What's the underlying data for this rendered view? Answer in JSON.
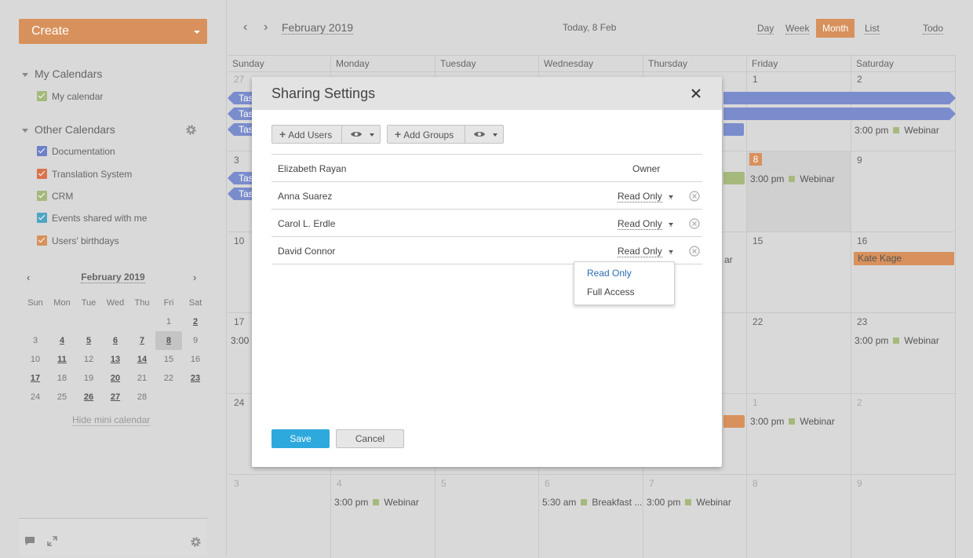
{
  "sidebar": {
    "create_label": "Create",
    "my_calendars_title": "My Calendars",
    "my_calendars": [
      {
        "label": "My calendar",
        "color": "#a6b97c"
      }
    ],
    "other_calendars_title": "Other Calendars",
    "other_calendars": [
      {
        "label": "Documentation",
        "color": "#6d80c8"
      },
      {
        "label": "Translation System",
        "color": "#d8744e"
      },
      {
        "label": "CRM",
        "color": "#a6b97c"
      },
      {
        "label": "Events shared with me",
        "color": "#4fa6c3"
      },
      {
        "label": "Users' birthdays",
        "color": "#d8915c"
      }
    ],
    "mini_calendar": {
      "title": "February 2019",
      "weekdays": [
        "Sun",
        "Mon",
        "Tue",
        "Wed",
        "Thu",
        "Fri",
        "Sat"
      ],
      "days": [
        {
          "d": "",
          "s": ""
        },
        {
          "d": "",
          "s": ""
        },
        {
          "d": "",
          "s": ""
        },
        {
          "d": "",
          "s": ""
        },
        {
          "d": "",
          "s": ""
        },
        {
          "d": "1",
          "s": ""
        },
        {
          "d": "2",
          "s": "b"
        },
        {
          "d": "3",
          "s": ""
        },
        {
          "d": "4",
          "s": "b"
        },
        {
          "d": "5",
          "s": "b"
        },
        {
          "d": "6",
          "s": "b"
        },
        {
          "d": "7",
          "s": "b"
        },
        {
          "d": "8",
          "s": "today"
        },
        {
          "d": "9",
          "s": ""
        },
        {
          "d": "10",
          "s": ""
        },
        {
          "d": "11",
          "s": "b"
        },
        {
          "d": "12",
          "s": ""
        },
        {
          "d": "13",
          "s": "b"
        },
        {
          "d": "14",
          "s": "b"
        },
        {
          "d": "15",
          "s": ""
        },
        {
          "d": "16",
          "s": ""
        },
        {
          "d": "17",
          "s": "b"
        },
        {
          "d": "18",
          "s": ""
        },
        {
          "d": "19",
          "s": ""
        },
        {
          "d": "20",
          "s": "b"
        },
        {
          "d": "21",
          "s": ""
        },
        {
          "d": "22",
          "s": ""
        },
        {
          "d": "23",
          "s": "b"
        },
        {
          "d": "24",
          "s": ""
        },
        {
          "d": "25",
          "s": ""
        },
        {
          "d": "26",
          "s": "b"
        },
        {
          "d": "27",
          "s": "b"
        },
        {
          "d": "28",
          "s": ""
        }
      ],
      "hide_label": "Hide mini calendar"
    }
  },
  "header": {
    "period_label": "February 2019",
    "today_label": "Today, 8 Feb",
    "views": {
      "day": "Day",
      "week": "Week",
      "month": "Month",
      "list": "List",
      "todo": "Todo"
    }
  },
  "calendar": {
    "weekdays": [
      "Sunday",
      "Monday",
      "Tuesday",
      "Wednesday",
      "Thursday",
      "Friday",
      "Saturday"
    ],
    "row1": {
      "sun": "27",
      "fri": "1",
      "sat": "2"
    },
    "row2": {
      "sun": "3",
      "fri": "8",
      "sat": "9"
    },
    "row3": {
      "sun": "10",
      "fri": "15",
      "sat": "16"
    },
    "row4": {
      "sun": "17",
      "fri": "22",
      "sat": "23"
    },
    "row5": {
      "sun": "24",
      "fri": "1",
      "sat": "2"
    },
    "row6": {
      "sun": "3",
      "mon": "4",
      "tue": "5",
      "wed": "6",
      "thu": "7",
      "fri": "8",
      "sat": "9"
    },
    "task_label": "Tas",
    "partial_time": "3:00 p",
    "partial_ar": "ar",
    "events": {
      "webinar_time": "3:00 pm",
      "webinar": "Webinar",
      "breakfast_time": "5:30 am",
      "breakfast": "Breakfast ...",
      "kate": "Kate Kage"
    },
    "colors": {
      "task": "#7a8ccc",
      "birthday": "#d8915c",
      "event": "#a6b97c"
    }
  },
  "modal": {
    "title": "Sharing Settings",
    "add_users": "Add Users",
    "add_groups": "Add Groups",
    "users": [
      {
        "name": "Elizabeth Rayan",
        "access": "Owner"
      },
      {
        "name": "Anna Suarez",
        "access": "Read Only"
      },
      {
        "name": "Carol L. Erdle",
        "access": "Read Only"
      },
      {
        "name": "David Connor",
        "access": "Read Only"
      }
    ],
    "dropdown_options": [
      "Read Only",
      "Full Access"
    ],
    "save": "Save",
    "cancel": "Cancel"
  }
}
